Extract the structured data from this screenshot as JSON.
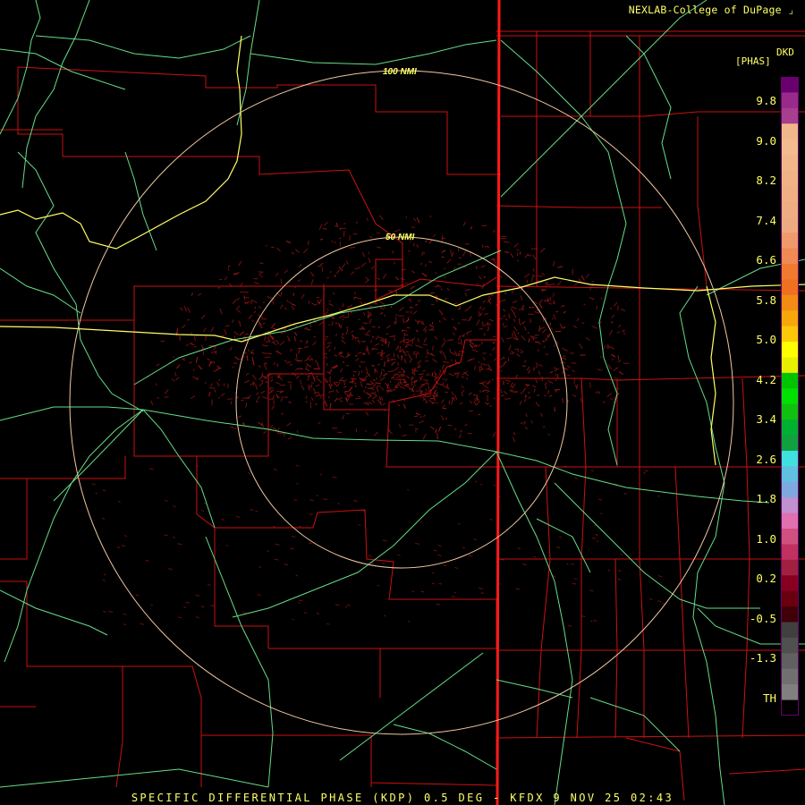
{
  "credit": "NEXLAB-College of DuPage",
  "legend": {
    "code": "DKD",
    "unit": "[PHAS]",
    "ticks": [
      "9.8",
      "9.0",
      "8.2",
      "7.4",
      "6.6",
      "5.8",
      "5.0",
      "4.2",
      "3.4",
      "2.6",
      "1.8",
      "1.0",
      "0.2",
      "-0.5",
      "-1.3",
      "TH"
    ],
    "colors": [
      "#6a0070",
      "#9a2a8a",
      "#a83e8e",
      "#f0b88a",
      "#f2bc8e",
      "#f1b78a",
      "#f0b386",
      "#efb084",
      "#eeac82",
      "#edaa80",
      "#ef9a6a",
      "#ee8a52",
      "#f07a30",
      "#f07020",
      "#f28c14",
      "#f6a80a",
      "#fcc808",
      "#ffff00",
      "#e8f000",
      "#00c400",
      "#00e000",
      "#10c010",
      "#00b030",
      "#10a040",
      "#40e0e0",
      "#60c0e0",
      "#80a8e0",
      "#c090d0",
      "#e070b0",
      "#d05080",
      "#c03060",
      "#a02040",
      "#880020",
      "#680010",
      "#400008",
      "#404040",
      "#505050",
      "#606060",
      "#707070",
      "#808080",
      "#000000"
    ]
  },
  "range_rings": {
    "inner_label": "50 NMI",
    "outer_label": "100 NMI"
  },
  "caption": "SPECIFIC DIFFERENTIAL PHASE (KDP) 0.5 DEG - KFDX 9 NOV 25 02:43",
  "colors": {
    "county_lines": "#cc1111",
    "state_line": "#ff1a1a",
    "highways": "#66dd88",
    "interstate": "#ffff66",
    "rings": "#f0c8a0",
    "text": "#ffff66"
  }
}
